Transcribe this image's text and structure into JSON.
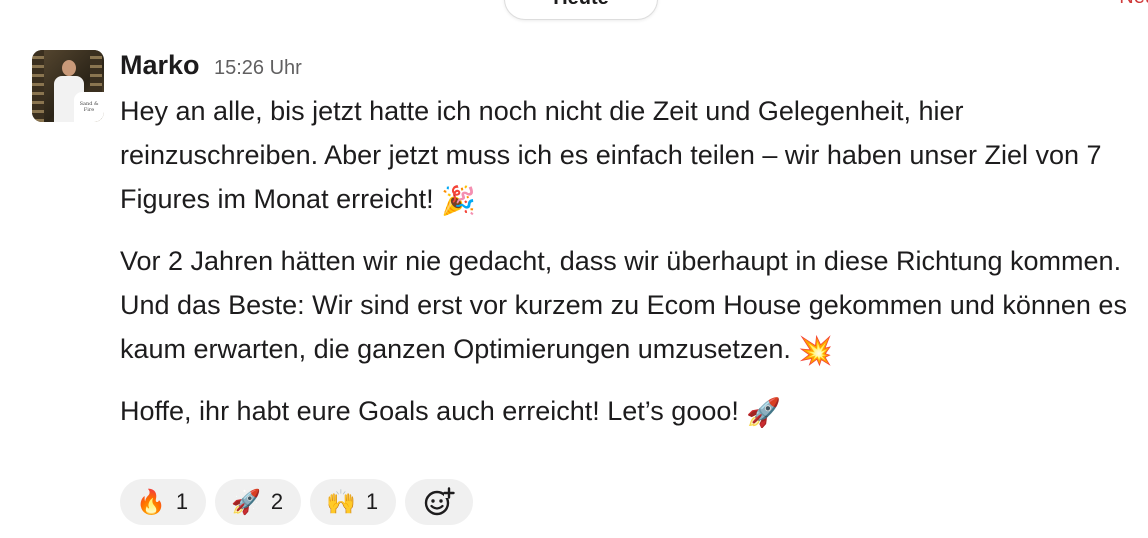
{
  "date_divider": {
    "label": "Heute"
  },
  "corner_link": {
    "label": "Neu"
  },
  "message": {
    "author": "Marko",
    "time": "15:26 Uhr",
    "avatar_badge_text": "Sand & Fire",
    "paragraph_1": "Hey an alle, bis jetzt hatte ich noch nicht die Zeit und Gelegenheit, hier reinzuschreiben. Aber jetzt muss ich es einfach teilen – wir haben unser Ziel von 7 Figures im Monat erreicht!",
    "paragraph_1_emoji": "🎉",
    "paragraph_2": "Vor 2 Jahren hätten wir nie gedacht, dass wir überhaupt in diese Richtung kommen. Und das Beste: Wir sind erst vor kurzem zu Ecom House gekommen und können es kaum erwarten, die ganzen Optimierungen umzusetzen.",
    "paragraph_2_emoji": "💥",
    "paragraph_3": "Hoffe, ihr habt eure Goals auch erreicht! Let’s gooo!",
    "paragraph_3_emoji": "🚀"
  },
  "reactions": [
    {
      "emoji": "🔥",
      "icon": "fire-icon",
      "count": "1"
    },
    {
      "emoji": "🚀",
      "icon": "rocket-icon",
      "count": "2"
    },
    {
      "emoji": "🙌",
      "icon": "raised-hands-icon",
      "count": "1"
    }
  ],
  "colors": {
    "text": "#1d1c1d",
    "muted": "#616061",
    "reaction_bg": "#f0f0f0",
    "link": "#d03b3b"
  }
}
